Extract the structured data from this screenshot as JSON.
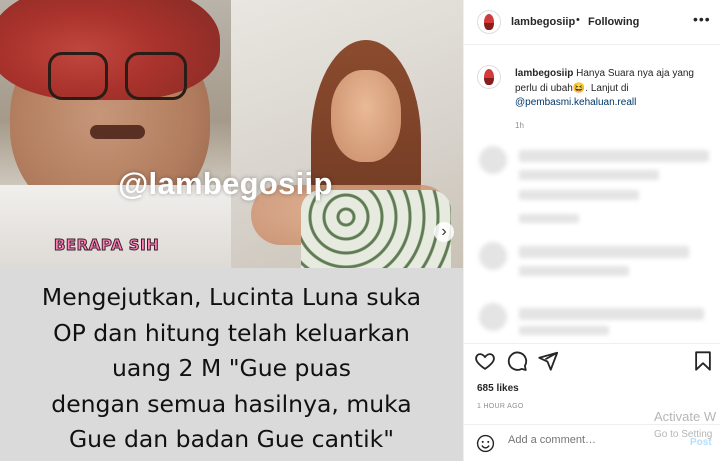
{
  "post": {
    "watermark": "@lambegosiip",
    "sticker": "BERAPA SIH",
    "caption_lines": [
      "Mengejutkan, Lucinta Luna suka",
      "OP dan hitung telah keluarkan",
      "uang 2 M \"Gue puas",
      "dengan semua hasilnya, muka",
      "Gue dan badan Gue cantik\""
    ]
  },
  "header": {
    "username": "lambegosiip",
    "separator": "•",
    "follow_state": "Following",
    "more": "•••"
  },
  "comment": {
    "username": "lambegosiip",
    "text_part1": "Hanya Suara nya aja yang perlu di ubah😆. Lanjut di",
    "link": "@pembasmi.kehaluan.reall",
    "time": "1h"
  },
  "stats": {
    "likes": "685 likes",
    "time_ago": "1 HOUR AGO"
  },
  "composer": {
    "placeholder": "Add a comment…",
    "post_label": "Post"
  },
  "overlay": {
    "activate_title": "Activate W",
    "activate_sub": "Go to Setting"
  },
  "icons": {
    "next": "›",
    "heart": "heart-icon",
    "comment": "comment-icon",
    "share": "share-icon",
    "save": "bookmark-icon",
    "emoji": "emoji-icon"
  }
}
